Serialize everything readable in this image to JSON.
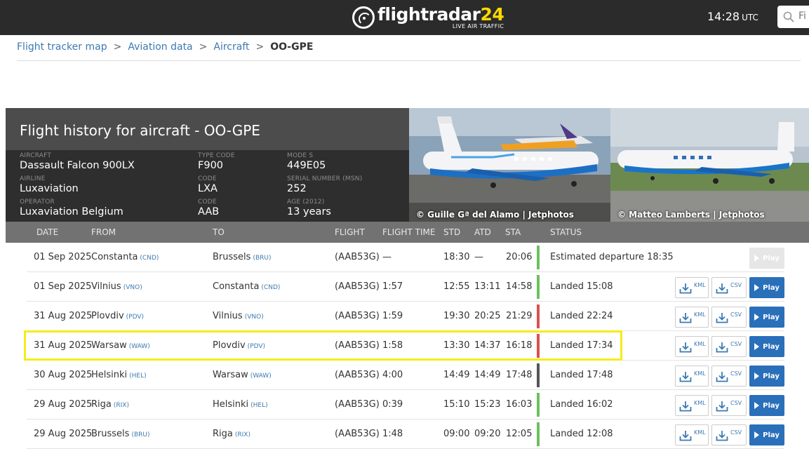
{
  "header": {
    "logo_name": "flightradar",
    "logo_num": "24",
    "logo_tag": "LIVE AIR TRAFFIC",
    "time": "14:28",
    "time_zone": "UTC",
    "search_placeholder": "Fi"
  },
  "breadcrumb": {
    "items": [
      "Flight tracker map",
      "Aviation data",
      "Aircraft"
    ],
    "separator": ">",
    "current": "OO-GPE"
  },
  "aircraft": {
    "title": "Flight history for aircraft - OO-GPE",
    "fields": {
      "aircraft": {
        "label": "AIRCRAFT",
        "value": "Dassault Falcon 900LX"
      },
      "type_code": {
        "label": "TYPE CODE",
        "value": "F900"
      },
      "mode_s": {
        "label": "MODE S",
        "value": "449E05"
      },
      "airline": {
        "label": "AIRLINE",
        "value": "Luxaviation"
      },
      "airline_code": {
        "label": "Code",
        "value": "LXA"
      },
      "msn": {
        "label": "SERIAL NUMBER (MSN)",
        "value": "252"
      },
      "operator": {
        "label": "OPERATOR",
        "value": "Luxaviation Belgium"
      },
      "operator_code": {
        "label": "Code",
        "value": "AAB"
      },
      "age": {
        "label": "AGE (2012)",
        "value": "13 years"
      }
    },
    "photos": [
      {
        "credit": "© Guille Gª del Alamo | Jetphotos"
      },
      {
        "credit": "© Matteo Lamberts | Jetphotos"
      }
    ]
  },
  "table": {
    "columns": {
      "date": "DATE",
      "from": "FROM",
      "to": "TO",
      "flight": "FLIGHT",
      "flight_time": "FLIGHT TIME",
      "std": "STD",
      "atd": "ATD",
      "sta": "STA",
      "status": "STATUS"
    },
    "buttons": {
      "kml": "KML",
      "csv": "CSV",
      "play": "Play"
    },
    "rows": [
      {
        "date": "01 Sep 2025",
        "from": "Constanta",
        "from_code": "(CND)",
        "to": "Brussels",
        "to_code": "(BRU)",
        "flight": "(AAB53G)",
        "flight_time": "—",
        "std": "18:30",
        "atd": "—",
        "sta": "20:06",
        "status": "Estimated departure 18:35",
        "bar_color": "#6dbf5f",
        "downloads": false
      },
      {
        "date": "01 Sep 2025",
        "from": "Vilnius",
        "from_code": "(VNO)",
        "to": "Constanta",
        "to_code": "(CND)",
        "flight": "(AAB53G)",
        "flight_time": "1:57",
        "std": "12:55",
        "atd": "13:11",
        "sta": "14:58",
        "status": "Landed 15:08",
        "bar_color": "#6dbf5f",
        "downloads": true
      },
      {
        "date": "31 Aug 2025",
        "from": "Plovdiv",
        "from_code": "(PDV)",
        "to": "Vilnius",
        "to_code": "(VNO)",
        "flight": "(AAB53G)",
        "flight_time": "1:59",
        "std": "19:30",
        "atd": "20:25",
        "sta": "21:29",
        "status": "Landed 22:24",
        "bar_color": "#d9534f",
        "downloads": true
      },
      {
        "date": "31 Aug 2025",
        "from": "Warsaw",
        "from_code": "(WAW)",
        "to": "Plovdiv",
        "to_code": "(PDV)",
        "flight": "(AAB53G)",
        "flight_time": "1:58",
        "std": "13:30",
        "atd": "14:37",
        "sta": "16:18",
        "status": "Landed 17:34",
        "bar_color": "#d9534f",
        "downloads": true
      },
      {
        "date": "30 Aug 2025",
        "from": "Helsinki",
        "from_code": "(HEL)",
        "to": "Warsaw",
        "to_code": "(WAW)",
        "flight": "(AAB53G)",
        "flight_time": "4:00",
        "std": "14:49",
        "atd": "14:49",
        "sta": "17:48",
        "status": "Landed 17:48",
        "bar_color": "#555555",
        "downloads": true
      },
      {
        "date": "29 Aug 2025",
        "from": "Riga",
        "from_code": "(RIX)",
        "to": "Helsinki",
        "to_code": "(HEL)",
        "flight": "(AAB53G)",
        "flight_time": "0:39",
        "std": "15:10",
        "atd": "15:23",
        "sta": "16:03",
        "status": "Landed 16:02",
        "bar_color": "#6dbf5f",
        "downloads": true
      },
      {
        "date": "29 Aug 2025",
        "from": "Brussels",
        "from_code": "(BRU)",
        "to": "Riga",
        "to_code": "(RIX)",
        "flight": "(AAB53G)",
        "flight_time": "1:48",
        "std": "09:00",
        "atd": "09:20",
        "sta": "12:05",
        "status": "Landed 12:08",
        "bar_color": "#6dbf5f",
        "downloads": true
      }
    ]
  },
  "colors": {
    "accent": "#3d7ab0",
    "play": "#2a6fba",
    "highlight": "#f5ec1a"
  }
}
